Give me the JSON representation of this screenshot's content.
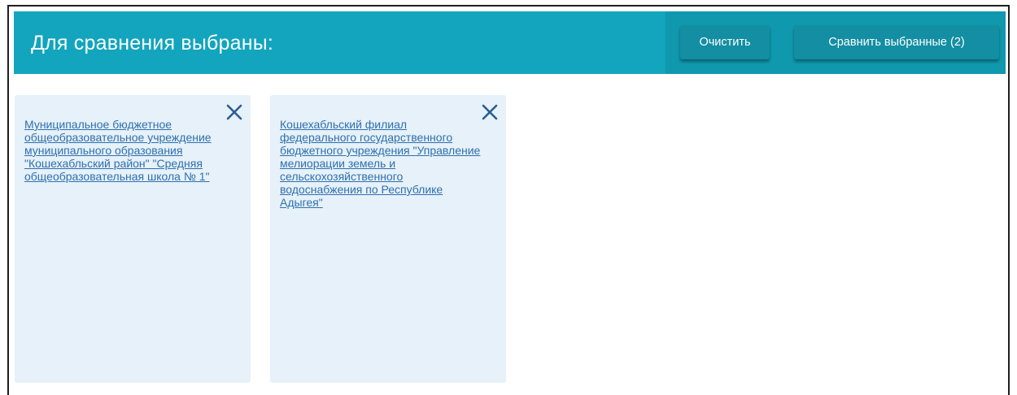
{
  "header": {
    "title": "Для сравнения выбраны:",
    "clear_label": "Очистить",
    "compare_label": "Сравнить выбранные (2)"
  },
  "cards": [
    {
      "title": "Муниципальное бюджетное общеобразовательное учреждение муниципального образования \"Кошехабльский район\" \"Средняя общеобразовательная школа № 1\"",
      "close_icon": "close-icon"
    },
    {
      "title": "Кошехабльский филиал федерального государственного бюджетного учреждения \"Управление мелиорации земель и сельскохозяйственного водоснабжения по Республике Адыгея\"",
      "close_icon": "close-icon"
    }
  ],
  "colors": {
    "header_bg": "#12a5bd",
    "button_panel_bg": "#0f98ae",
    "button_bg": "#138ea2",
    "card_bg": "#e6f1f9",
    "link": "#2f6fae",
    "close_icon": "#2a5d8f"
  }
}
